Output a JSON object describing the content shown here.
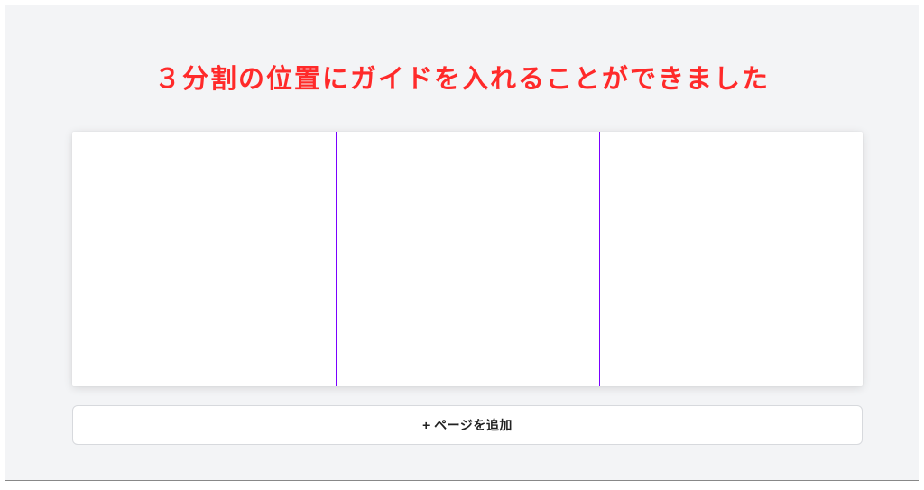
{
  "heading": "３分割の位置にガイドを入れることができました",
  "canvas": {
    "guide_count": 2
  },
  "add_page_button": {
    "label": "+ ページを追加"
  },
  "colors": {
    "heading": "#ff2a2a",
    "guide": "#7a00ff",
    "background": "#f3f4f6"
  }
}
